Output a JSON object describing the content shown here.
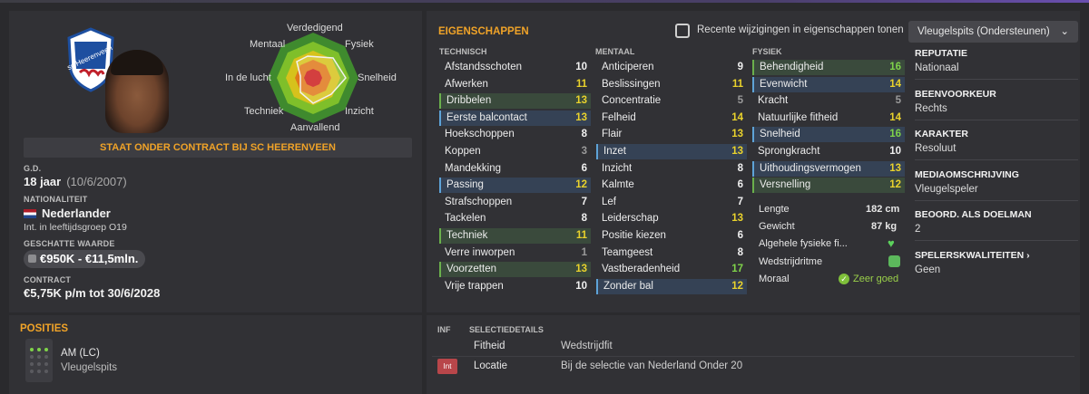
{
  "radar_labels": {
    "top": "Verdedigend",
    "tr": "Fysiek",
    "r": "Snelheid",
    "br": "Inzicht",
    "bottom": "Aanvallend",
    "bl": "Techniek",
    "l": "In de lucht",
    "tl": "Mentaal"
  },
  "contract_banner": "STAAT ONDER CONTRACT BIJ SC HEERENVEEN",
  "club_crest_text": "sc Heerenveen",
  "dob": {
    "label": "G.D.",
    "age": "18 jaar",
    "date": "(10/6/2007)"
  },
  "nationality": {
    "label": "NATIONALITEIT",
    "value": "Nederlander",
    "sub": "Int. in leeftijdsgroep O19"
  },
  "value": {
    "label": "GESCHATTE WAARDE",
    "value": "€950K - €11,5mln."
  },
  "contract": {
    "label": "CONTRACT",
    "value": "€5,75K p/m tot 30/6/2028"
  },
  "attributes": {
    "title": "EIGENSCHAPPEN",
    "show_changes": "Recente wijzigingen in eigenschappen tonen",
    "role_dropdown": "Vleugelspits (Ondersteunen)",
    "technisch": {
      "header": "TECHNISCH",
      "rows": [
        [
          "Afstandsschoten",
          "10",
          "w",
          ""
        ],
        [
          "Afwerken",
          "11",
          "y",
          ""
        ],
        [
          "Dribbelen",
          "13",
          "y",
          "g"
        ],
        [
          "Eerste balcontact",
          "13",
          "y",
          "b"
        ],
        [
          "Hoekschoppen",
          "8",
          "w",
          ""
        ],
        [
          "Koppen",
          "3",
          "gr",
          ""
        ],
        [
          "Mandekking",
          "6",
          "w",
          ""
        ],
        [
          "Passing",
          "12",
          "y",
          "b"
        ],
        [
          "Strafschoppen",
          "7",
          "w",
          ""
        ],
        [
          "Tackelen",
          "8",
          "w",
          ""
        ],
        [
          "Techniek",
          "11",
          "y",
          "g"
        ],
        [
          "Verre inworpen",
          "1",
          "gr",
          ""
        ],
        [
          "Voorzetten",
          "13",
          "y",
          "g"
        ],
        [
          "Vrije trappen",
          "10",
          "w",
          ""
        ]
      ]
    },
    "mentaal": {
      "header": "MENTAAL",
      "rows": [
        [
          "Anticiperen",
          "9",
          "w",
          ""
        ],
        [
          "Beslissingen",
          "11",
          "y",
          ""
        ],
        [
          "Concentratie",
          "5",
          "gr",
          ""
        ],
        [
          "Felheid",
          "14",
          "y",
          ""
        ],
        [
          "Flair",
          "13",
          "y",
          ""
        ],
        [
          "Inzet",
          "13",
          "y",
          "b"
        ],
        [
          "Inzicht",
          "8",
          "w",
          ""
        ],
        [
          "Kalmte",
          "6",
          "w",
          ""
        ],
        [
          "Lef",
          "7",
          "w",
          ""
        ],
        [
          "Leiderschap",
          "13",
          "y",
          ""
        ],
        [
          "Positie kiezen",
          "6",
          "w",
          ""
        ],
        [
          "Teamgeest",
          "8",
          "w",
          ""
        ],
        [
          "Vastberadenheid",
          "17",
          "g",
          ""
        ],
        [
          "Zonder bal",
          "12",
          "y",
          "b"
        ]
      ]
    },
    "fysiek": {
      "header": "FYSIEK",
      "rows": [
        [
          "Behendigheid",
          "16",
          "g",
          "g"
        ],
        [
          "Evenwicht",
          "14",
          "y",
          "b"
        ],
        [
          "Kracht",
          "5",
          "gr",
          ""
        ],
        [
          "Natuurlijke fitheid",
          "14",
          "y",
          ""
        ],
        [
          "Snelheid",
          "16",
          "g",
          "b"
        ],
        [
          "Sprongkracht",
          "10",
          "w",
          ""
        ],
        [
          "Uithoudingsvermogen",
          "13",
          "y",
          "b"
        ],
        [
          "Versnelling",
          "12",
          "y",
          "g"
        ]
      ]
    },
    "misc": {
      "height_label": "Lengte",
      "height": "182 cm",
      "weight_label": "Gewicht",
      "weight": "87 kg",
      "fitness_label": "Algehele fysieke fi...",
      "match_label": "Wedstrijdritme",
      "morale_label": "Moraal",
      "morale": "Zeer goed"
    }
  },
  "side": [
    {
      "title": "REPUTATIE",
      "value": "Nationaal"
    },
    {
      "title": "BEENVOORKEUR",
      "value": "Rechts"
    },
    {
      "title": "KARAKTER",
      "value": "Resoluut"
    },
    {
      "title": "MEDIAOMSCHRIJVING",
      "value": "Vleugelspeler"
    },
    {
      "title": "BEOORD. ALS DOELMAN",
      "value": "2"
    },
    {
      "title": "SPELERSKWALITEITEN ›",
      "value": "Geen"
    }
  ],
  "positions": {
    "title": "POSITIES",
    "pos": "AM (LC)",
    "role": "Vleugelspits"
  },
  "selection": {
    "col1": "INF",
    "col2": "SELECTIEDETAILS",
    "rows": [
      {
        "k": "Fitheid",
        "v": "Wedstrijdfit",
        "badge": ""
      },
      {
        "k": "Locatie",
        "v": "Bij de selectie van Nederland Onder 20",
        "badge": "Int"
      }
    ]
  }
}
